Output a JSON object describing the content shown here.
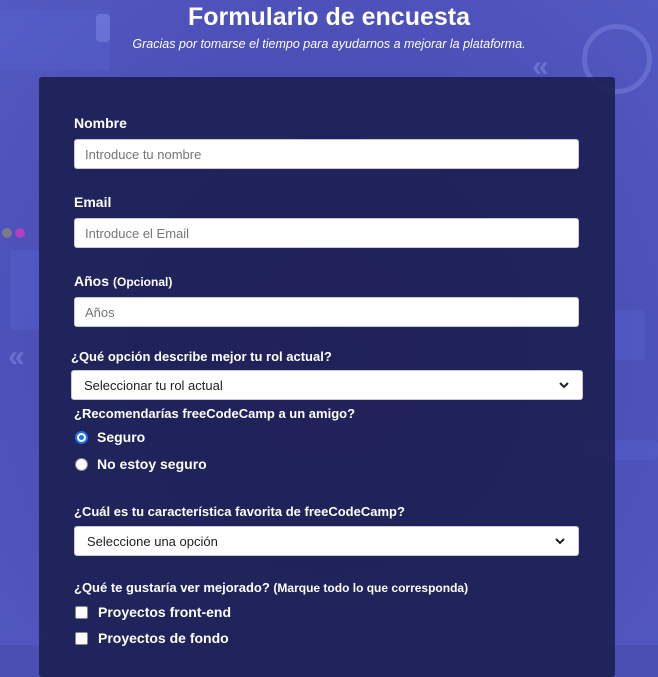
{
  "colors": {
    "accent": "#1a73e8",
    "card": "#1b1e4e",
    "background": "#4a4fb4"
  },
  "header": {
    "title": "Formulario de encuesta",
    "subtitle": "Gracias por tomarse el tiempo para ayudarnos a mejorar la plataforma."
  },
  "form": {
    "name": {
      "label": "Nombre",
      "placeholder": "Introduce tu nombre"
    },
    "email": {
      "label": "Email",
      "placeholder": "Introduce el Email"
    },
    "age": {
      "label": "Años",
      "optional": "(Opcional)",
      "placeholder": "Años"
    },
    "role": {
      "label": "¿Qué opción describe mejor tu rol actual?",
      "selected": "Seleccionar tu rol actual"
    },
    "recommend": {
      "label": "¿Recomendarías freeCodeCamp a un amigo?",
      "options": [
        {
          "label": "Seguro",
          "checked": true
        },
        {
          "label": "No estoy seguro",
          "checked": false
        }
      ]
    },
    "favorite": {
      "label": "¿Cuál es tu característica favorita de freeCodeCamp?",
      "selected": "Seleccione una opción"
    },
    "improve": {
      "label": "¿Qué te gustaría ver mejorado?",
      "hint": "(Marque todo lo que corresponda)",
      "options": [
        {
          "label": "Proyectos front-end",
          "checked": false
        },
        {
          "label": "Proyectos de fondo",
          "checked": false
        }
      ]
    }
  },
  "icons": {
    "select_arrow": "chevron-down-icon"
  }
}
